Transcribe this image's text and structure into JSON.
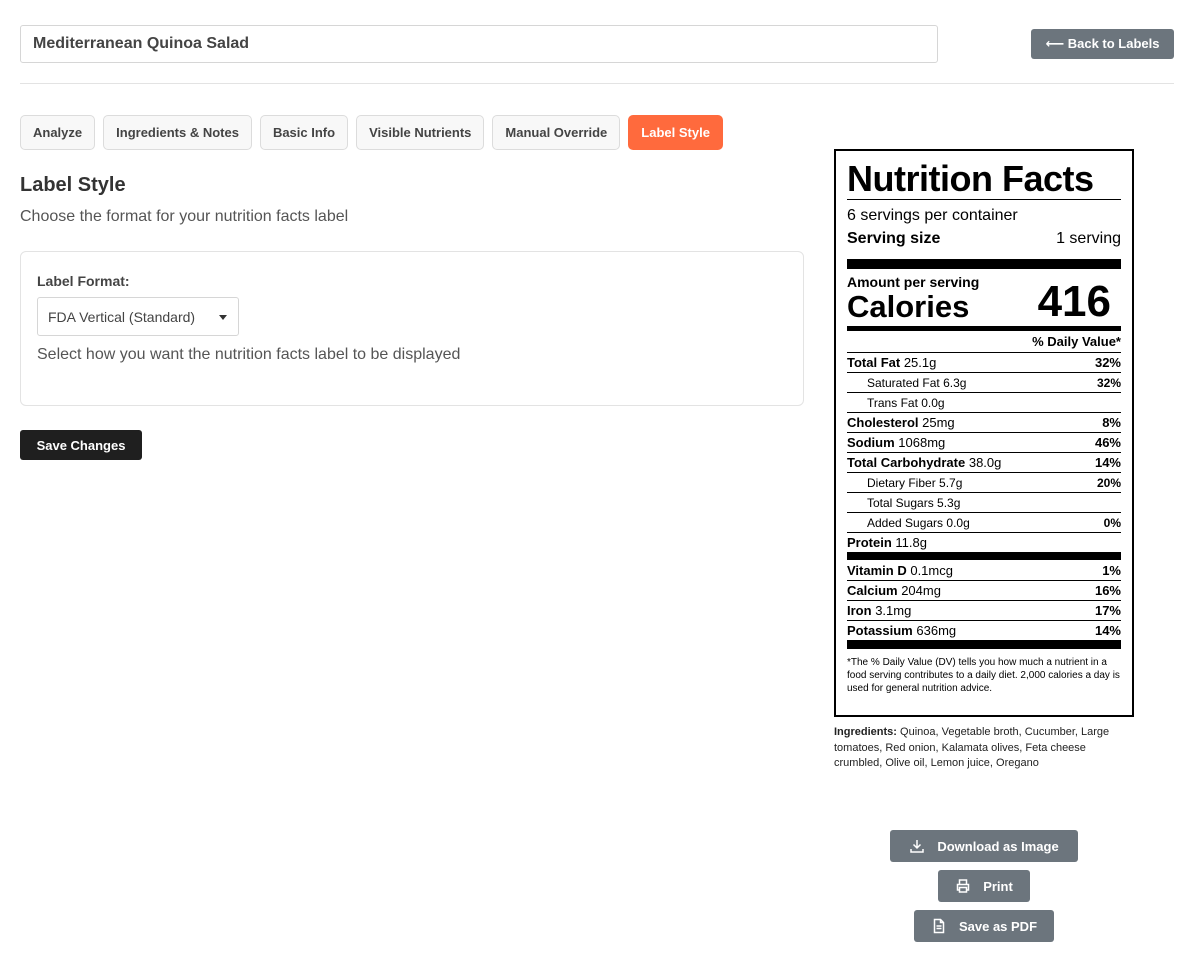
{
  "header": {
    "recipe_name": "Mediterranean Quinoa Salad",
    "back_label": "⟵ Back to Labels"
  },
  "tabs": [
    {
      "label": "Analyze",
      "active": false
    },
    {
      "label": "Ingredients & Notes",
      "active": false
    },
    {
      "label": "Basic Info",
      "active": false
    },
    {
      "label": "Visible Nutrients",
      "active": false
    },
    {
      "label": "Manual Override",
      "active": false
    },
    {
      "label": "Label Style",
      "active": true
    }
  ],
  "section": {
    "title": "Label Style",
    "subtitle": "Choose the format for your nutrition facts label"
  },
  "form": {
    "label": "Label Format:",
    "selected": "FDA Vertical (Standard)",
    "help": "Select how you want the nutrition facts label to be displayed",
    "save_label": "Save Changes"
  },
  "nutrition": {
    "title": "Nutrition Facts",
    "servings": "6 servings per container",
    "serving_size_label": "Serving size",
    "serving_size_value": "1 serving",
    "amount_label": "Amount per serving",
    "calories_label": "Calories",
    "calories_value": "416",
    "dv_header": "% Daily Value*",
    "rows": {
      "total_fat": {
        "name": "Total Fat",
        "amount": "25.1g",
        "dv": "32%"
      },
      "sat_fat": {
        "name": "Saturated Fat",
        "amount": "6.3g",
        "dv": "32%"
      },
      "trans_fat": {
        "name": "Trans Fat",
        "amount": "0.0g",
        "dv": ""
      },
      "cholesterol": {
        "name": "Cholesterol",
        "amount": "25mg",
        "dv": "8%"
      },
      "sodium": {
        "name": "Sodium",
        "amount": "1068mg",
        "dv": "46%"
      },
      "total_carb": {
        "name": "Total Carbohydrate",
        "amount": "38.0g",
        "dv": "14%"
      },
      "fiber": {
        "name": "Dietary Fiber",
        "amount": "5.7g",
        "dv": "20%"
      },
      "total_sugars": {
        "name": "Total Sugars",
        "amount": "5.3g",
        "dv": ""
      },
      "added_sugars": {
        "name": "Added Sugars",
        "amount": "0.0g",
        "dv": "0%"
      },
      "protein": {
        "name": "Protein",
        "amount": "11.8g",
        "dv": ""
      },
      "vitamin_d": {
        "name": "Vitamin D",
        "amount": "0.1mcg",
        "dv": "1%"
      },
      "calcium": {
        "name": "Calcium",
        "amount": "204mg",
        "dv": "16%"
      },
      "iron": {
        "name": "Iron",
        "amount": "3.1mg",
        "dv": "17%"
      },
      "potassium": {
        "name": "Potassium",
        "amount": "636mg",
        "dv": "14%"
      }
    },
    "footnote": "*The % Daily Value (DV) tells you how much a nutrient in a food serving contributes to a daily diet. 2,000 calories a day is used for general nutrition advice."
  },
  "ingredients": {
    "label": "Ingredients:",
    "text": "Quinoa, Vegetable broth, Cucumber, Large tomatoes, Red onion, Kalamata olives, Feta cheese crumbled, Olive oil, Lemon juice, Oregano"
  },
  "actions": {
    "download_label": "Download as Image",
    "print_label": "Print",
    "pdf_label": "Save as PDF"
  },
  "colors": {
    "accent": "#ff6a3d",
    "secondary_button": "#6c757d",
    "primary_button": "#1f1f1f"
  }
}
